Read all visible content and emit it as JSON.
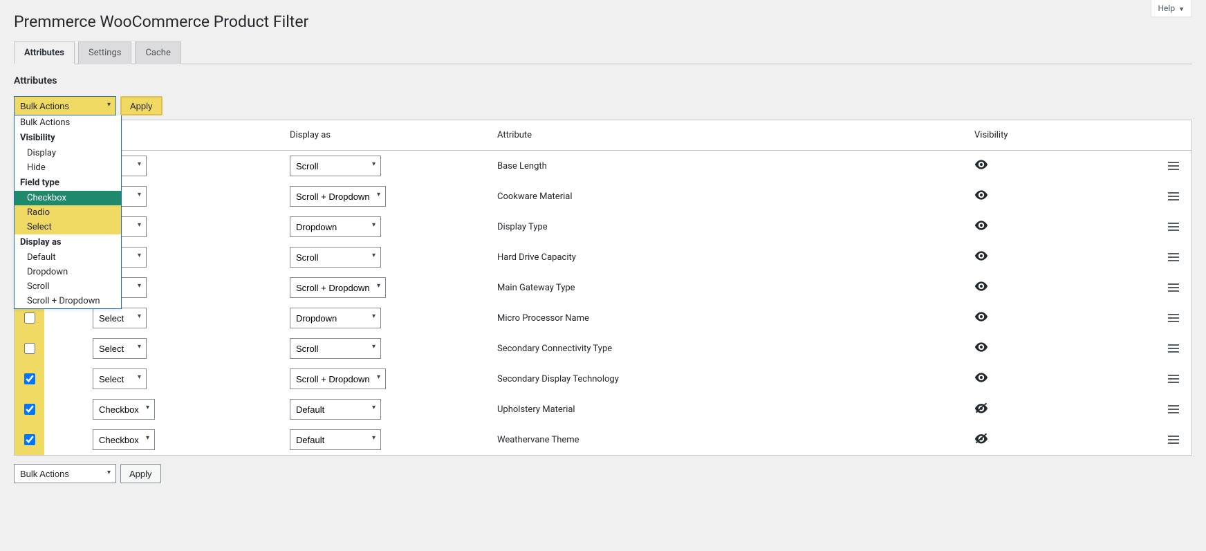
{
  "help_label": "Help",
  "page_title": "Premmerce WooCommerce Product Filter",
  "tabs": {
    "attributes": "Attributes",
    "settings": "Settings",
    "cache": "Cache"
  },
  "section_heading": "Attributes",
  "bulk": {
    "selected_top": "Bulk Actions",
    "apply": "Apply",
    "selected_bottom": "Bulk Actions"
  },
  "dropdown": {
    "bulk_actions": "Bulk Actions",
    "grp_visibility": "Visibility",
    "display": "Display",
    "hide": "Hide",
    "grp_field_type": "Field type",
    "checkbox": "Checkbox",
    "radio": "Radio",
    "select": "Select",
    "grp_display_as": "Display as",
    "default": "Default",
    "dropdown": "Dropdown",
    "scroll": "Scroll",
    "scroll_dropdown": "Scroll + Dropdown"
  },
  "columns": {
    "display_as": "Display as",
    "attribute": "Attribute",
    "visibility": "Visibility"
  },
  "rows": [
    {
      "checked": false,
      "field_type": "",
      "display_as": "Scroll",
      "attribute": "Base Length",
      "visible": true
    },
    {
      "checked": false,
      "field_type": "",
      "display_as": "Scroll + Dropdown",
      "attribute": "Cookware Material",
      "visible": true
    },
    {
      "checked": false,
      "field_type": "",
      "display_as": "Dropdown",
      "attribute": "Display Type",
      "visible": true
    },
    {
      "checked": false,
      "field_type": "",
      "display_as": "Scroll",
      "attribute": "Hard Drive Capacity",
      "visible": true
    },
    {
      "checked": false,
      "field_type": "",
      "display_as": "Scroll + Dropdown",
      "attribute": "Main Gateway Type",
      "visible": true
    },
    {
      "checked": false,
      "field_type": "Select",
      "display_as": "Dropdown",
      "attribute": "Micro Processor Name",
      "visible": true
    },
    {
      "checked": false,
      "field_type": "Select",
      "display_as": "Scroll",
      "attribute": "Secondary Connectivity Type",
      "visible": true
    },
    {
      "checked": true,
      "field_type": "Select",
      "display_as": "Scroll + Dropdown",
      "attribute": "Secondary Display Technology",
      "visible": true
    },
    {
      "checked": true,
      "field_type": "Checkbox",
      "display_as": "Default",
      "attribute": "Upholstery Material",
      "visible": false
    },
    {
      "checked": true,
      "field_type": "Checkbox",
      "display_as": "Default",
      "attribute": "Weathervane Theme",
      "visible": false
    }
  ]
}
